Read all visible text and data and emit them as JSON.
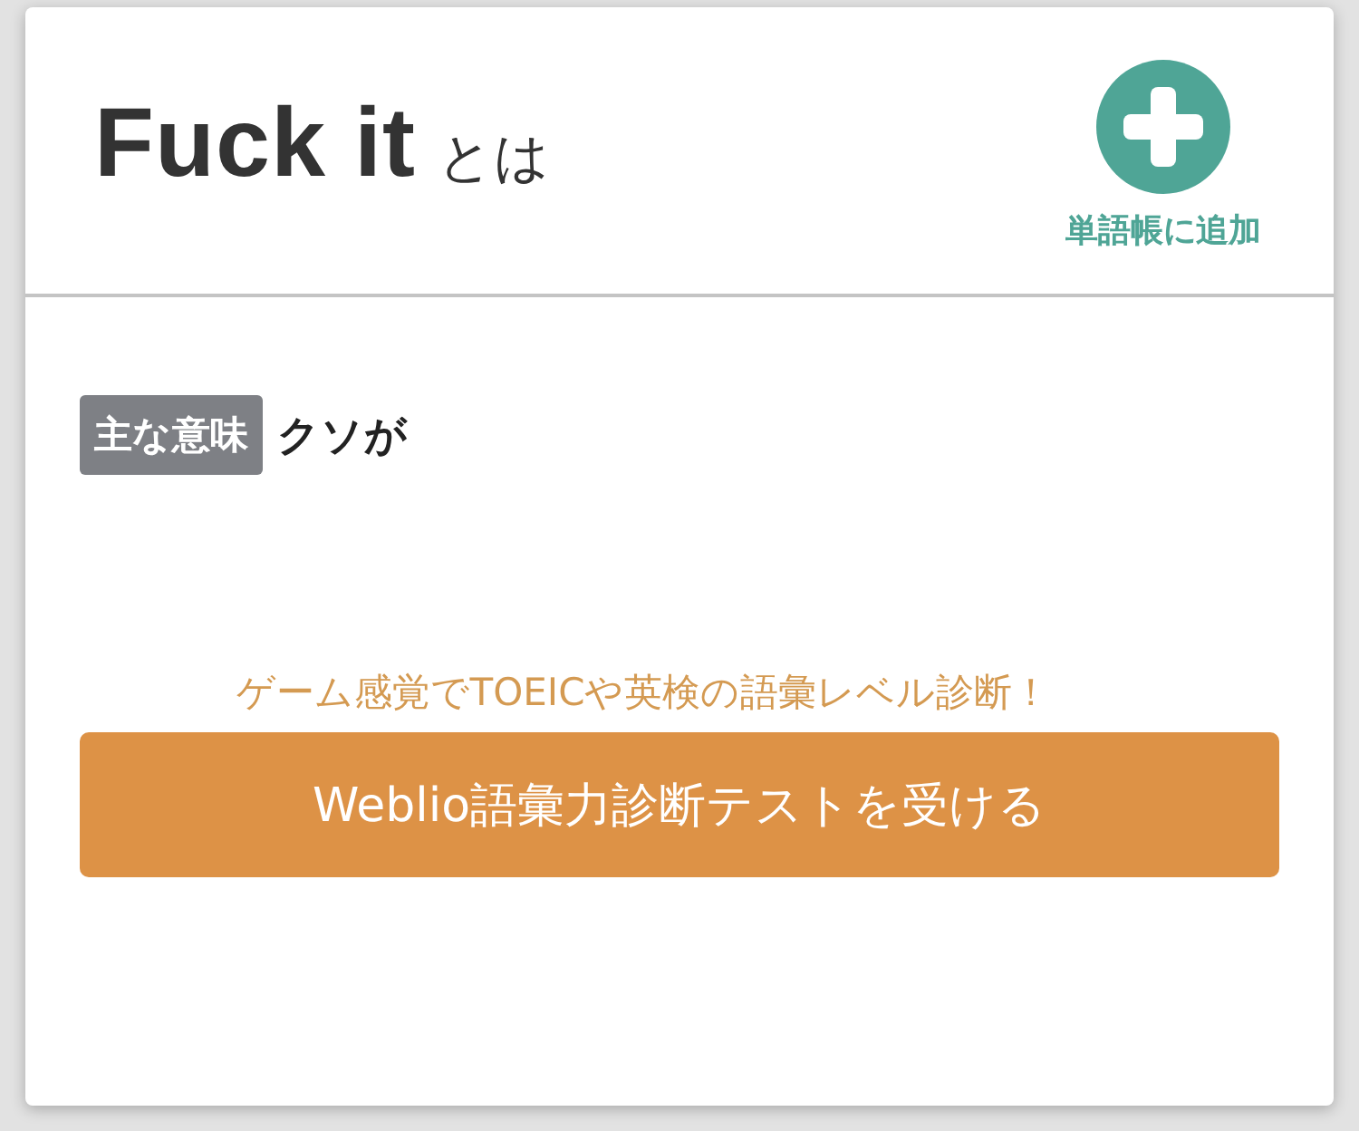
{
  "header": {
    "term": "Fuck it",
    "suffix": "とは",
    "add_button": {
      "label": "単語帳に追加"
    }
  },
  "meaning": {
    "badge": "主な意味",
    "text": "クソが"
  },
  "promo": {
    "tagline": "ゲーム感覚でTOEICや英検の語彙レベル診断！",
    "button": "Weblio語彙力診断テストを受ける"
  }
}
